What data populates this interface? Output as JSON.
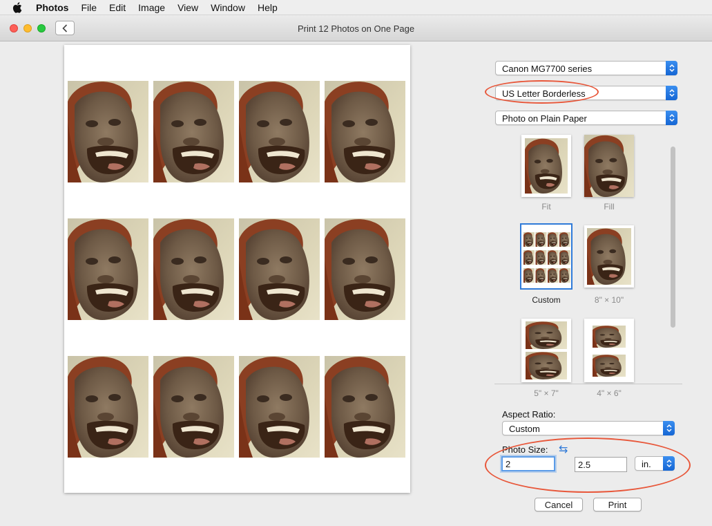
{
  "menubar": {
    "app_name": "Photos",
    "items": [
      "File",
      "Edit",
      "Image",
      "View",
      "Window",
      "Help"
    ]
  },
  "window": {
    "title": "Print 12 Photos on One Page"
  },
  "printer": {
    "selected": "Canon MG7700 series"
  },
  "paper_size": {
    "selected": "US Letter Borderless"
  },
  "paper_type": {
    "selected": "Photo on Plain Paper"
  },
  "layouts": [
    {
      "label": "Fit",
      "selected": false
    },
    {
      "label": "Fill",
      "selected": false
    },
    {
      "label": "Custom",
      "selected": true
    },
    {
      "label": "8\" × 10\"",
      "selected": false
    },
    {
      "label": "5\" × 7\"",
      "selected": false
    },
    {
      "label": "4\" × 6\"",
      "selected": false
    }
  ],
  "aspect_ratio": {
    "label": "Aspect Ratio:",
    "selected": "Custom"
  },
  "photo_size": {
    "label": "Photo Size:",
    "width": "2",
    "height": "2.5",
    "unit": "in."
  },
  "buttons": {
    "cancel": "Cancel",
    "print": "Print"
  },
  "colors": {
    "accent": "#2f7ad8",
    "annotation": "#e8573a"
  }
}
